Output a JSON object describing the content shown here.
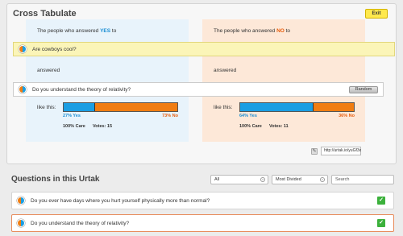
{
  "header": {
    "title": "Cross Tabulate",
    "exit_label": "Exit"
  },
  "columns": {
    "yes": {
      "prefix": "The people who answered",
      "highlight": "YES",
      "suffix": "to",
      "answered_label": "answered",
      "like_label": "like this:",
      "yes_pct_label": "27% Yes",
      "no_pct_label": "73% No",
      "yes_fraction": 0.27,
      "care_label": "100% Care",
      "votes_label": "Votes: 15"
    },
    "no": {
      "prefix": "The people who answered",
      "highlight": "NO",
      "suffix": "to",
      "answered_label": "answered",
      "like_label": "like this:",
      "yes_pct_label": "64% Yes",
      "no_pct_label": "36% No",
      "yes_fraction": 0.64,
      "care_label": "100% Care",
      "votes_label": "Votes: 11"
    }
  },
  "question_filter": {
    "text": "Are cowboys cool?"
  },
  "question_main": {
    "text": "Do you understand the theory of relativity?",
    "random_label": "Random"
  },
  "share": {
    "url": "http://urtak.io/yuGf3x"
  },
  "questions": {
    "title": "Questions in this Urtak",
    "filter_all": "All",
    "filter_sort": "Most Divided",
    "search_placeholder": "Search",
    "items": [
      {
        "text": "Do you ever have days where you hurt yourself physically more than normal?"
      },
      {
        "text": "Do you understand the theory of relativity?"
      }
    ]
  },
  "colors": {
    "yes": "#1a9ee3",
    "no": "#f07d12",
    "accent": "#ffe94d"
  }
}
